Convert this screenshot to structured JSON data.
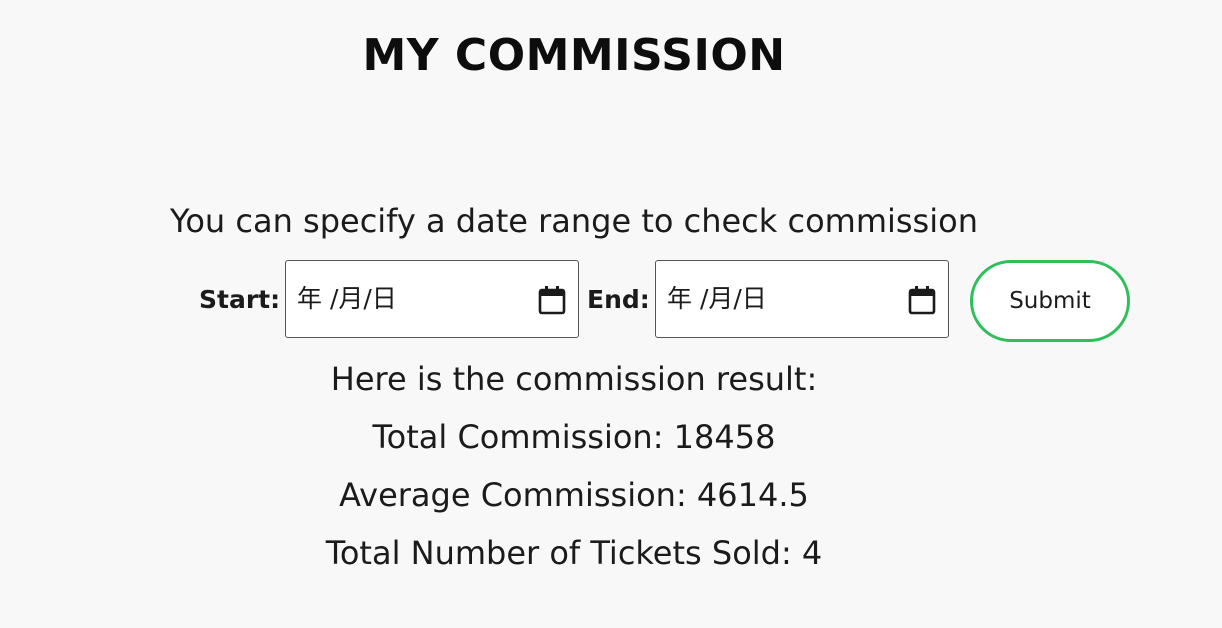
{
  "header": {
    "title": "MY COMMISSION"
  },
  "filter": {
    "instruction": "You can specify a date range to check commission",
    "start_label": "Start:",
    "start_value": "年 /月/日",
    "end_label": "End:",
    "end_value": "年 /月/日",
    "submit_label": "Submit"
  },
  "result": {
    "heading": "Here is the commission result:",
    "total_commission": "Total Commission: 18458",
    "average_commission": "Average Commission: 4614.5",
    "tickets_sold": "Total Number of Tickets Sold: 4"
  },
  "colors": {
    "background": "#f8f8f8",
    "submit_border": "#2fbf5a",
    "input_border": "#555555"
  },
  "icons": {
    "start_picker": "calendar-icon",
    "end_picker": "calendar-icon"
  }
}
